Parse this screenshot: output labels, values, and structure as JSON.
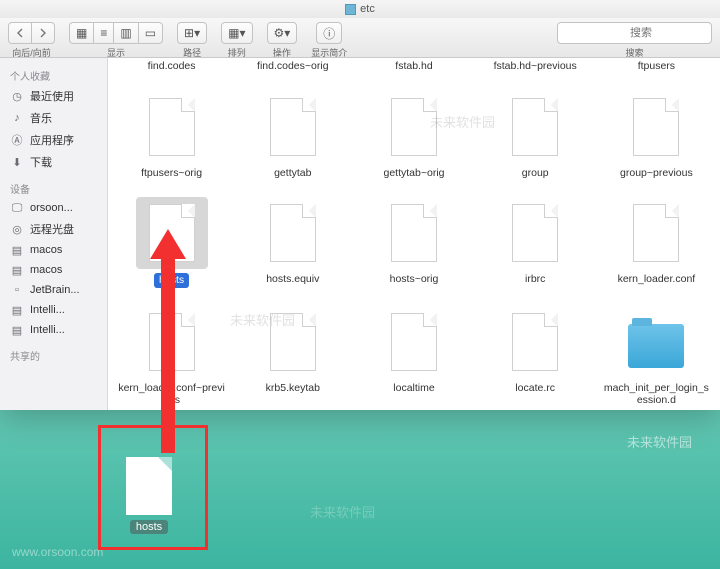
{
  "titlebar": {
    "title": "etc"
  },
  "toolbar": {
    "back_forward_label": "向后/向前",
    "view_label": "显示",
    "path_label": "路径",
    "arrange_label": "排列",
    "action_label": "操作",
    "info_label": "显示简介",
    "search_label": "搜索",
    "search_placeholder": "搜索"
  },
  "sidebar": {
    "favorites_header": "个人收藏",
    "favorites": [
      {
        "label": "最近使用",
        "icon": "clock"
      },
      {
        "label": "音乐",
        "icon": "music"
      },
      {
        "label": "应用程序",
        "icon": "apps"
      },
      {
        "label": "下载",
        "icon": "download"
      }
    ],
    "devices_header": "设备",
    "devices": [
      {
        "label": "orsoon...",
        "icon": "monitor"
      },
      {
        "label": "远程光盘",
        "icon": "disc"
      },
      {
        "label": "macos",
        "icon": "disk"
      },
      {
        "label": "macos",
        "icon": "disk"
      },
      {
        "label": "JetBrain...",
        "icon": "doc"
      },
      {
        "label": "Intelli...",
        "icon": "disk"
      },
      {
        "label": "Intelli...",
        "icon": "disk"
      }
    ],
    "shared_header": "共享的"
  },
  "files": {
    "row0": [
      "find.codes",
      "find.codes~orig",
      "fstab.hd",
      "fstab.hd~previous",
      "ftpusers"
    ],
    "row1": [
      "ftpusers~orig",
      "gettytab",
      "gettytab~orig",
      "group",
      "group~previous"
    ],
    "row2": [
      "hosts",
      "hosts.equiv",
      "hosts~orig",
      "irbrc",
      "kern_loader.conf"
    ],
    "row3": [
      "kern_loader.conf~previous",
      "krb5.keytab",
      "localtime",
      "locate.rc",
      "mach_init_per_login_session.d"
    ]
  },
  "selected_file": "hosts",
  "desktop_file": "hosts",
  "watermark": "未来软件园"
}
